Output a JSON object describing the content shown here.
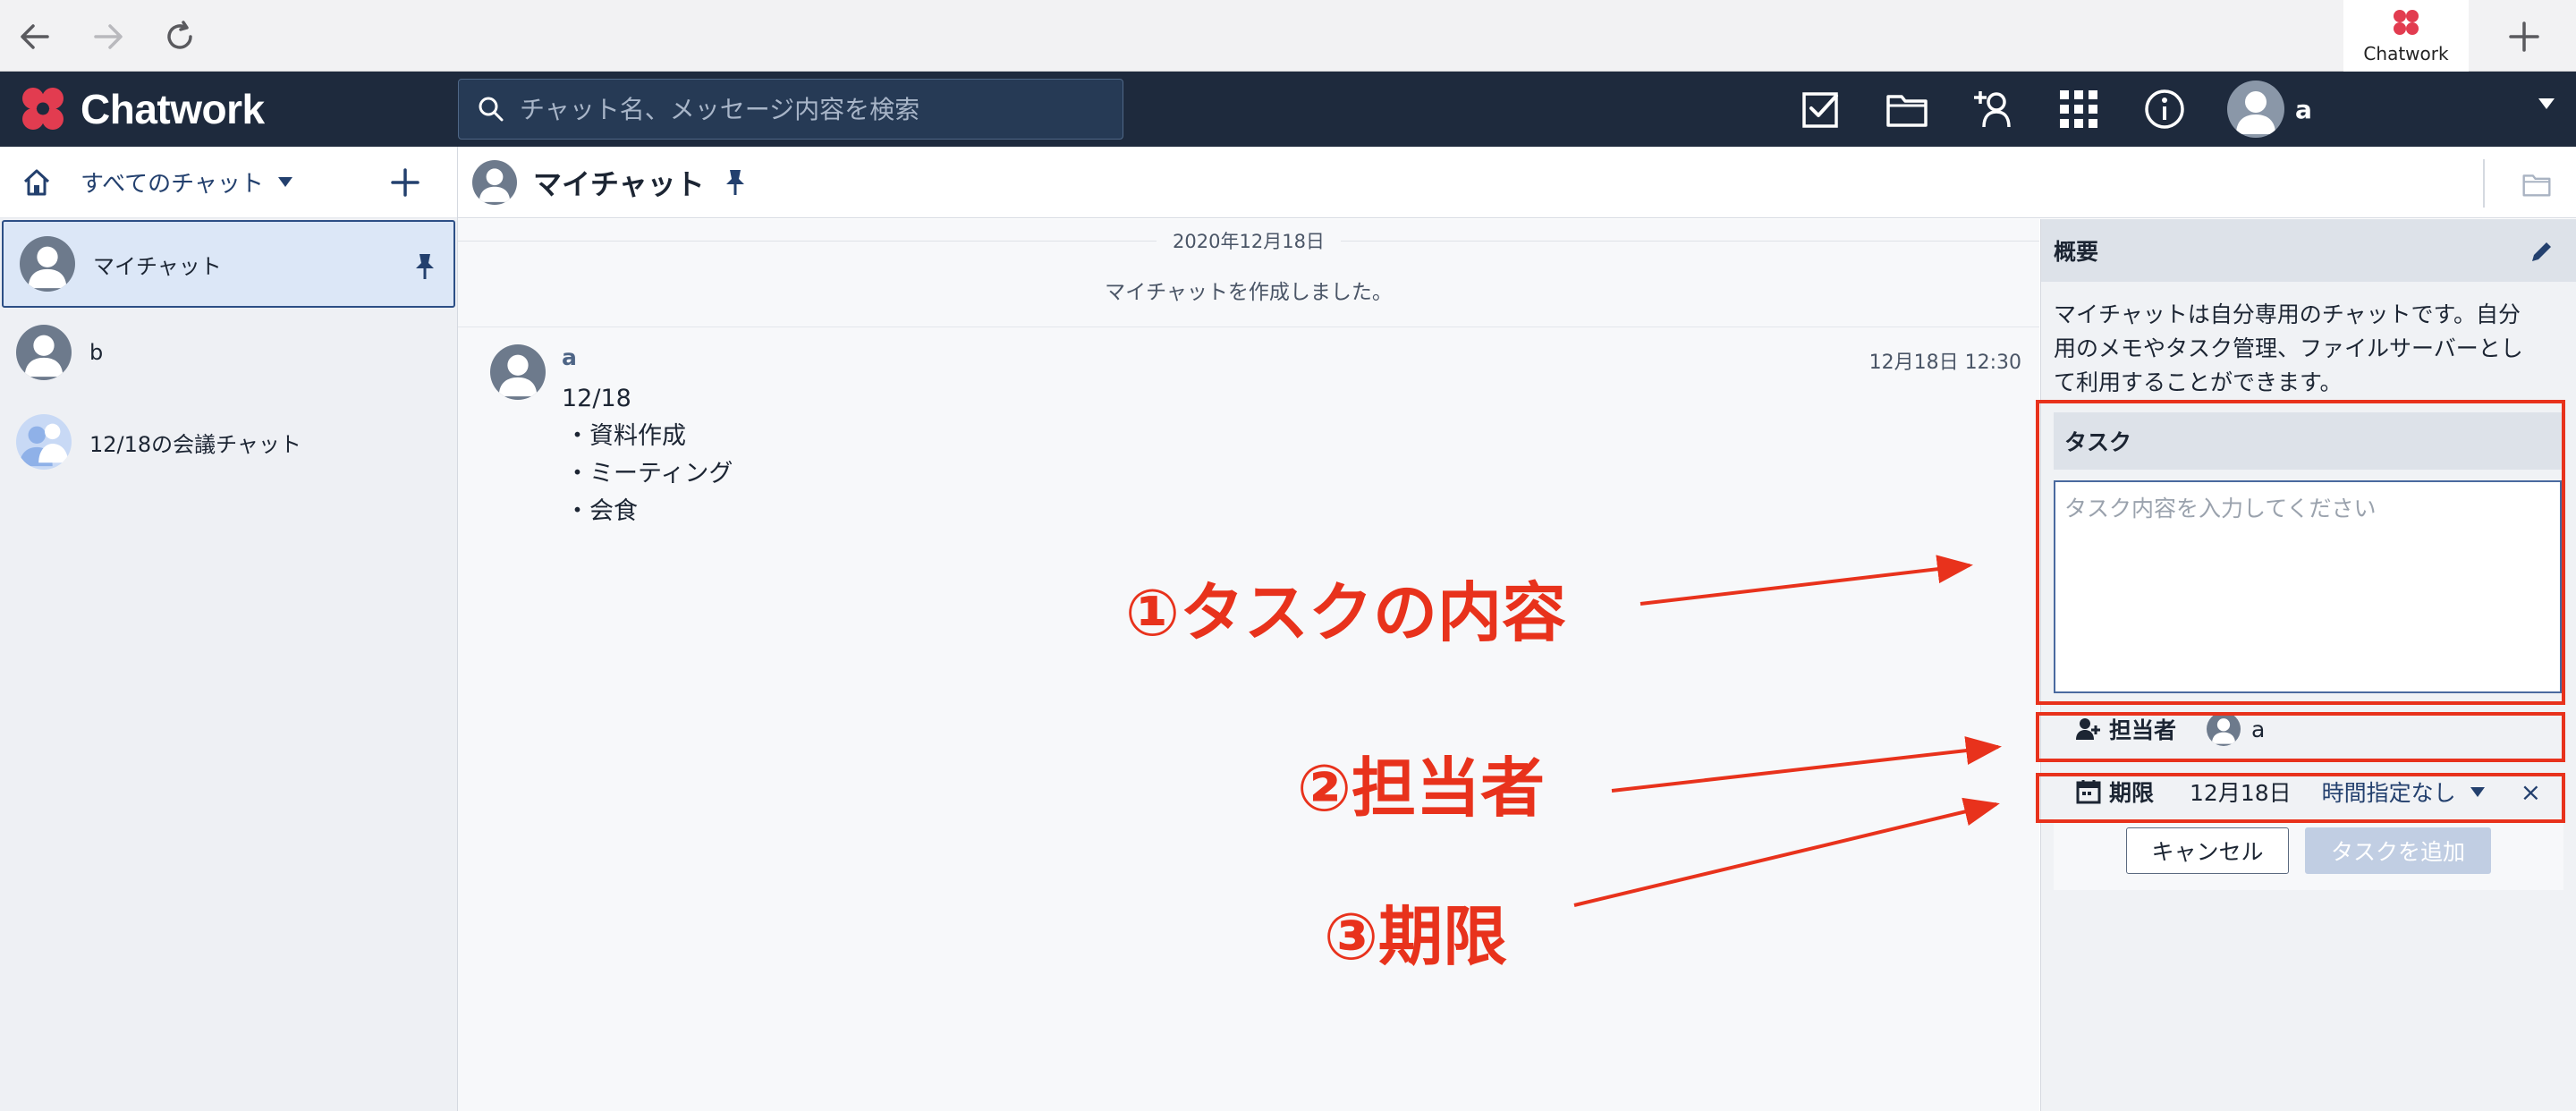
{
  "browser": {
    "tab_label": "Chatwork"
  },
  "header": {
    "logo_text": "Chatwork",
    "search_placeholder": "チャット名、メッセージ内容を検索",
    "user_name": "a"
  },
  "sidebar": {
    "filter_label": "すべてのチャット",
    "rooms": [
      {
        "name": "マイチャット",
        "active": true,
        "pinned": true
      },
      {
        "name": "b",
        "active": false,
        "pinned": false
      },
      {
        "name": "12/18の会議チャット",
        "active": false,
        "pinned": false
      }
    ]
  },
  "room": {
    "title": "マイチャット"
  },
  "timeline": {
    "date": "2020年12月18日",
    "system_message": "マイチャットを作成しました。",
    "message": {
      "sender": "a",
      "time": "12月18日 12:30",
      "lines": [
        "12/18",
        "・資料作成",
        "・ミーティング",
        "・会食"
      ]
    }
  },
  "panel": {
    "overview_title": "概要",
    "overview_text": "マイチャットは自分専用のチャットです。自分用のメモやタスク管理、ファイルサーバーとして利用することができます。",
    "task_title": "タスク",
    "task_placeholder": "タスク内容を入力してください",
    "assignee_label": "担当者",
    "assignee_name": "a",
    "due_label": "期限",
    "due_date": "12月18日",
    "time_option": "時間指定なし",
    "clear_symbol": "×",
    "cancel_label": "キャンセル",
    "add_label": "タスクを追加"
  },
  "annotations": {
    "content_label": "①タスクの内容",
    "assignee_label": "②担当者",
    "due_label": "③期限"
  },
  "colors": {
    "header_bg": "#1e2a3d",
    "accent": "#23406e",
    "annotation": "#e8321c",
    "logo_red": "#e23c50"
  }
}
